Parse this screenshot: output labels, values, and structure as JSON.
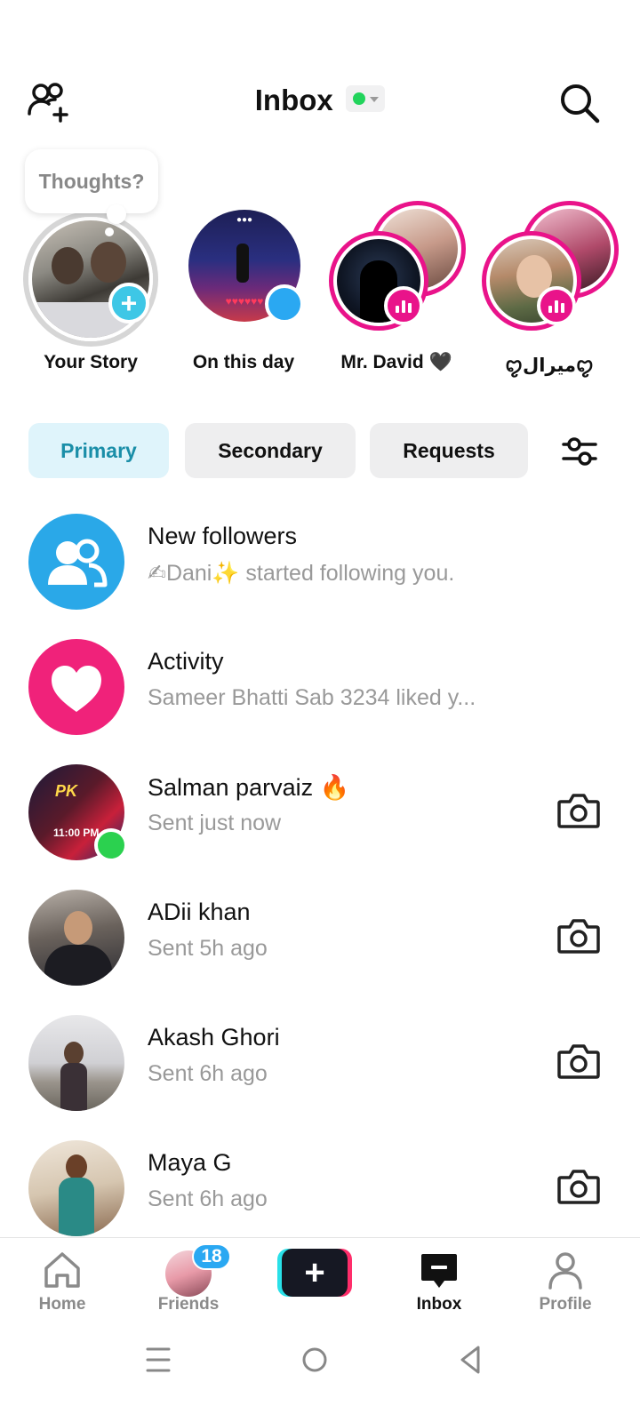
{
  "header": {
    "title": "Inbox",
    "status_color": "#22d45c"
  },
  "thoughts_bubble": {
    "text": "Thoughts?"
  },
  "stories": [
    {
      "label": "Your Story"
    },
    {
      "label": "On this day"
    },
    {
      "label": "Mr. David 🖤"
    },
    {
      "label": "ꨄ︎ميرالꨄ︎"
    }
  ],
  "tabs": [
    {
      "label": "Primary",
      "active": true
    },
    {
      "label": "Secondary",
      "active": false
    },
    {
      "label": "Requests",
      "active": false
    }
  ],
  "messages": [
    {
      "title": "New followers",
      "subtitle": "✍Dani✨ started following you."
    },
    {
      "title": "Activity",
      "subtitle": "Sameer  Bhatti Sab 3234 liked y..."
    },
    {
      "title": "Salman parvaiz 🔥",
      "subtitle": "Sent just now"
    },
    {
      "title": "ADii khan",
      "subtitle": "Sent 5h ago"
    },
    {
      "title": "Akash Ghori",
      "subtitle": "Sent 6h ago"
    },
    {
      "title": "Maya G",
      "subtitle": "Sent 6h ago"
    }
  ],
  "bottom_nav": {
    "home": "Home",
    "friends": "Friends",
    "friends_badge": "18",
    "inbox": "Inbox",
    "profile": "Profile"
  },
  "colors": {
    "accent_cyan": "#3ec7e6",
    "accent_pink": "#e9138a",
    "active_tab_bg": "#dff4fb",
    "active_tab_text": "#1a8ea8"
  }
}
